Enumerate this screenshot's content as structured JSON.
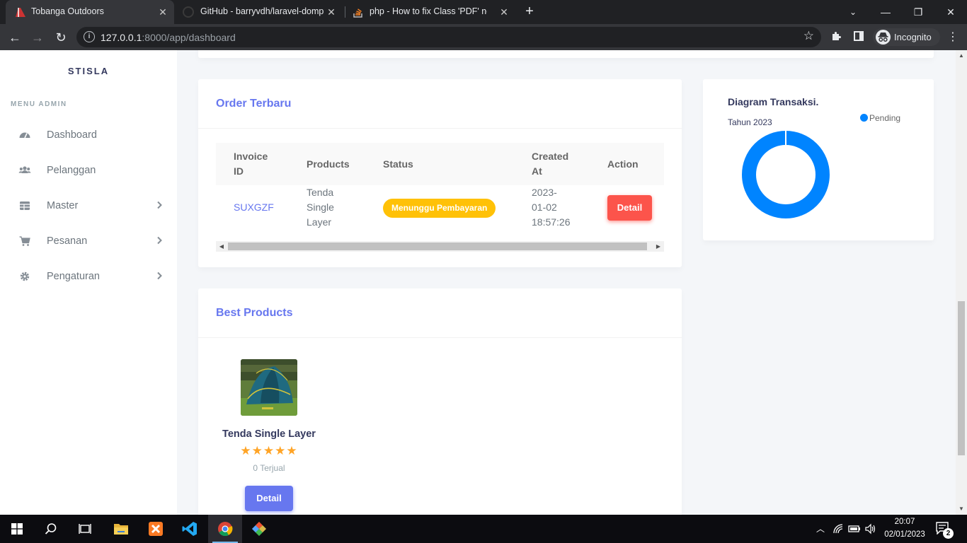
{
  "browser": {
    "tabs": [
      {
        "title": "Tobanga Outdoors",
        "active": true
      },
      {
        "title": "GitHub - barryvdh/laravel-dompc",
        "active": false
      },
      {
        "title": "php - How to fix Class 'PDF' not f",
        "active": false
      }
    ],
    "url_host": "127.0.0.1",
    "url_path": ":8000/app/dashboard",
    "profile_label": "Incognito"
  },
  "sidebar": {
    "brand": "STISLA",
    "menu_header": "MENU ADMIN",
    "items": [
      {
        "label": "Dashboard",
        "icon": "dashboard-icon",
        "has_submenu": false
      },
      {
        "label": "Pelanggan",
        "icon": "users-icon",
        "has_submenu": false
      },
      {
        "label": "Master",
        "icon": "table-icon",
        "has_submenu": true
      },
      {
        "label": "Pesanan",
        "icon": "cart-icon",
        "has_submenu": true
      },
      {
        "label": "Pengaturan",
        "icon": "gear-icon",
        "has_submenu": true
      }
    ]
  },
  "orders": {
    "title": "Order Terbaru",
    "columns": {
      "invoice_line1": "Invoice",
      "invoice_line2": "ID",
      "products": "Products",
      "status": "Status",
      "created_line1": "Created",
      "created_line2": "At",
      "action": "Action"
    },
    "rows": [
      {
        "invoice_id": "SUXGZF",
        "product_line1": "Tenda",
        "product_line2": "Single",
        "product_line3": "Layer",
        "status": "Menunggu Pembayaran",
        "created_line1": "2023-",
        "created_line2": "01-02",
        "created_line3": "18:57:26",
        "action_label": "Detail"
      }
    ]
  },
  "best_products": {
    "title": "Best Products",
    "items": [
      {
        "name": "Tenda Single Layer",
        "rating": 5,
        "rating_max": 5,
        "sold_text": "0 Terjual",
        "button_label": "Detail"
      }
    ]
  },
  "diagram": {
    "title": "Diagram Transaksi.",
    "subtitle": "Tahun 2023",
    "chart_data": {
      "type": "pie",
      "categories": [
        "Pending"
      ],
      "values": [
        1
      ],
      "legend": "top-right",
      "colors": [
        "#0084ff"
      ]
    }
  },
  "taskbar": {
    "time": "20:07",
    "date": "02/01/2023",
    "notification_count": "2"
  },
  "colors": {
    "primary": "#6777ef",
    "danger": "#fc544b",
    "warning": "#ffc107",
    "chart_blue": "#0084ff"
  }
}
